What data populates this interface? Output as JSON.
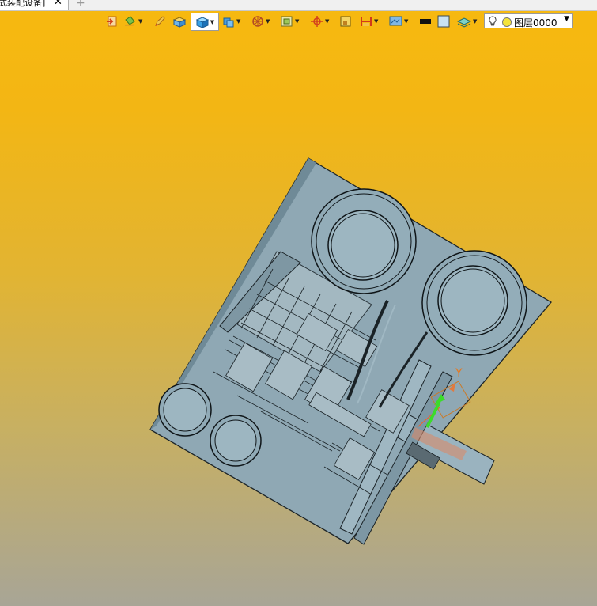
{
  "tab": {
    "label": "式装配设备]",
    "close_glyph": "✕",
    "add_glyph": "+"
  },
  "toolbar": {
    "tools": [
      {
        "name": "exit-sketch",
        "icon": "exit-icon"
      },
      {
        "name": "paint",
        "icon": "paint-bucket-icon"
      },
      {
        "name": "pencil",
        "icon": "pencil-icon"
      },
      {
        "name": "box",
        "icon": "box-icon"
      },
      {
        "name": "shaded-view",
        "icon": "shaded-cube-icon"
      },
      {
        "name": "view-style",
        "icon": "cube-view-icon"
      },
      {
        "name": "section",
        "icon": "section-wheel-icon"
      },
      {
        "name": "frame",
        "icon": "frame-icon"
      },
      {
        "name": "datum",
        "icon": "datum-icon"
      },
      {
        "name": "square",
        "icon": "square-icon"
      },
      {
        "name": "dimension",
        "icon": "dimension-icon"
      },
      {
        "name": "render",
        "icon": "render-screen-icon"
      },
      {
        "name": "line-color",
        "icon": "black-line-icon"
      },
      {
        "name": "fill-color",
        "icon": "fill-color-icon"
      },
      {
        "name": "layers",
        "icon": "layers-icon"
      }
    ],
    "colors": {
      "accent": "#3a8fd6",
      "icon_orange": "#e08a1e"
    }
  },
  "layer": {
    "name": "图层0000"
  },
  "axis": {
    "y_label": "Y"
  },
  "colors": {
    "model_fill": "#8fa8b4",
    "model_line": "#1a2226",
    "axis_y": "#3bdc2a",
    "axis_x": "#e07a40"
  }
}
